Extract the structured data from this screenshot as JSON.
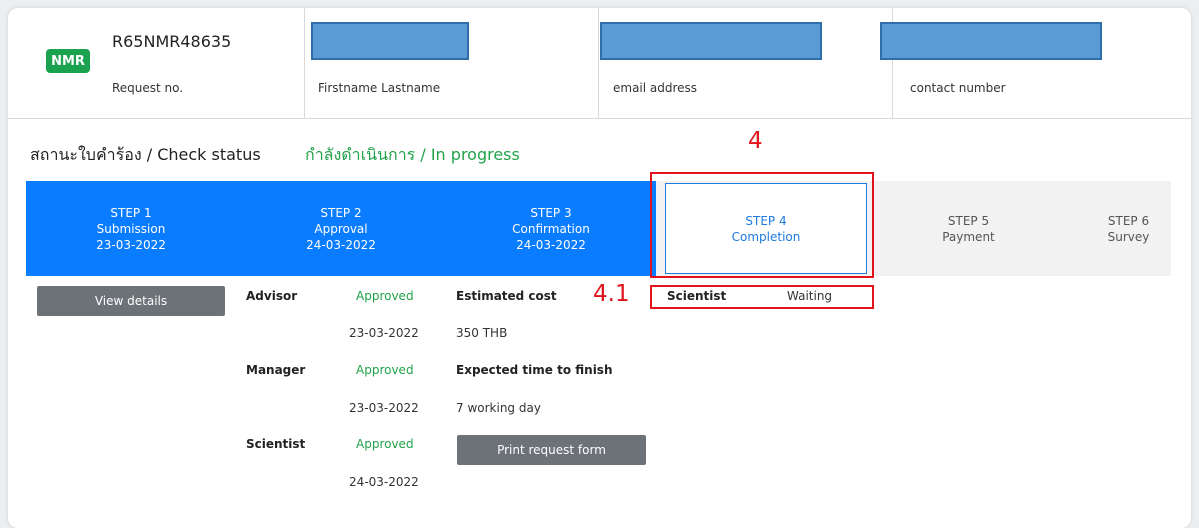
{
  "header": {
    "badge": "NMR",
    "request_no": "R65NMR48635",
    "request_label": "Request no.",
    "name_label": "Firstname Lastname",
    "email_label": "email address",
    "contact_label": "contact number"
  },
  "status": {
    "label": "สถานะใบคำร้อง / Check status",
    "value": "กำลังดำเนินการ / In progress"
  },
  "annotations": {
    "step_marker": "4",
    "sub_marker": "4.1"
  },
  "steps": [
    {
      "title": "STEP 1",
      "name": "Submission",
      "date": "23-03-2022"
    },
    {
      "title": "STEP 2",
      "name": "Approval",
      "date": "24-03-2022"
    },
    {
      "title": "STEP 3",
      "name": "Confirmation",
      "date": "24-03-2022"
    },
    {
      "title": "STEP 4",
      "name": "Completion",
      "date": ""
    },
    {
      "title": "STEP 5",
      "name": "Payment",
      "date": ""
    },
    {
      "title": "STEP 6",
      "name": "Survey",
      "date": ""
    }
  ],
  "details": {
    "view_button": "View details",
    "approvals": [
      {
        "role": "Advisor",
        "status": "Approved",
        "date": "23-03-2022"
      },
      {
        "role": "Manager",
        "status": "Approved",
        "date": "23-03-2022"
      },
      {
        "role": "Scientist",
        "status": "Approved",
        "date": "24-03-2022"
      }
    ],
    "cost_label": "Estimated cost",
    "cost_value": "350 THB",
    "time_label": "Expected time to finish",
    "time_value": "7 working day",
    "print_button": "Print request form",
    "completion": {
      "role": "Scientist",
      "status": "Waiting"
    }
  },
  "colors": {
    "step_done": "#0a7cff",
    "step_current_text": "#1f7ae0",
    "approved": "#21a24a",
    "annotation_red": "#e1141b",
    "redaction": "#5b9bd5",
    "badge": "#1aa24f"
  }
}
